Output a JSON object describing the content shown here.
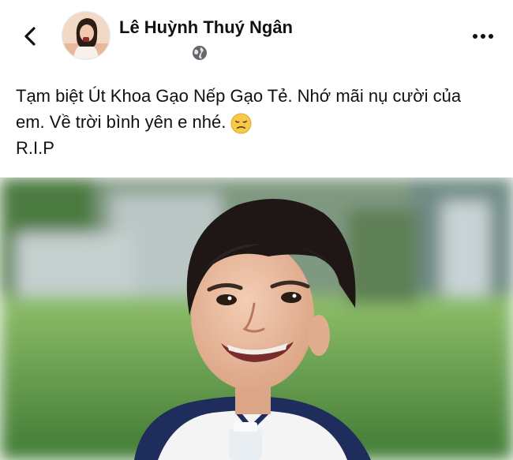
{
  "post": {
    "author_name": "Lê Huỳnh Thuý Ngân",
    "text_line1": "Tạm biệt Út Khoa Gạo Nếp Gạo Tẻ. Nhớ mãi nụ cười của",
    "text_line2": "em. Về trời bình yên e nhé.",
    "text_line3": "R.I.P",
    "emoji": "disappointed-face",
    "privacy": "public"
  },
  "icons": {
    "back": "chevron-left-icon",
    "more": "more-horizontal-icon",
    "privacy": "globe-icon"
  }
}
